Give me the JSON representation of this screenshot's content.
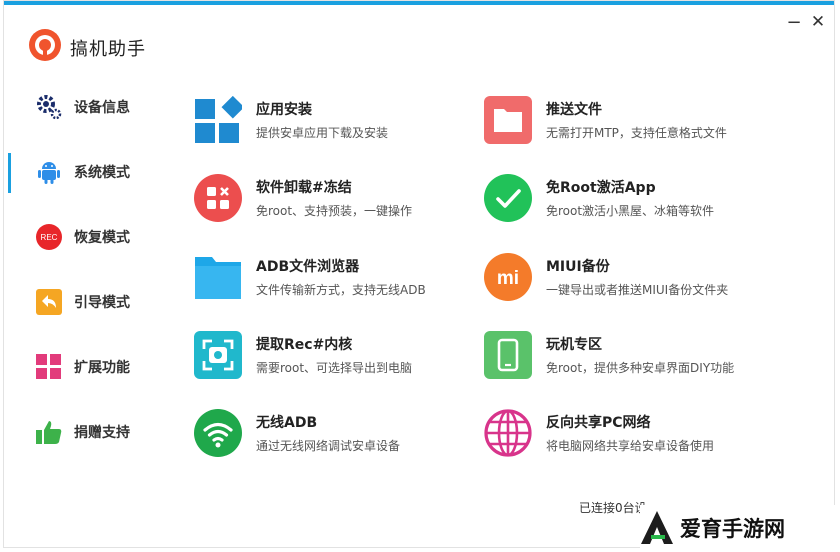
{
  "app": {
    "title": "搞机助手"
  },
  "window": {
    "minimize": "−",
    "close": "✕"
  },
  "sidebar": {
    "items": [
      {
        "label": "设备信息",
        "icon": "gear-icon"
      },
      {
        "label": "系统模式",
        "icon": "android-icon",
        "active": true
      },
      {
        "label": "恢复模式",
        "icon": "rec-icon",
        "badge": "REC"
      },
      {
        "label": "引导模式",
        "icon": "back-arrow-icon"
      },
      {
        "label": "扩展功能",
        "icon": "grid-icon"
      },
      {
        "label": "捐赠支持",
        "icon": "thumbs-up-icon"
      }
    ]
  },
  "features": {
    "left": [
      {
        "title": "应用安装",
        "desc": "提供安卓应用下载及安装",
        "icon": "app-install-icon"
      },
      {
        "title": "软件卸载#冻结",
        "desc": "免root、支持预装，一键操作",
        "icon": "uninstall-icon"
      },
      {
        "title": "ADB文件浏览器",
        "desc": "文件传输新方式，支持无线ADB",
        "icon": "folder-icon"
      },
      {
        "title": "提取Rec#内核",
        "desc": "需要root、可选择导出到电脑",
        "icon": "extract-icon"
      },
      {
        "title": "无线ADB",
        "desc": "通过无线网络调试安卓设备",
        "icon": "wifi-icon"
      }
    ],
    "right": [
      {
        "title": "推送文件",
        "desc": "无需打开MTP，支持任意格式文件",
        "icon": "push-file-icon"
      },
      {
        "title": "免Root激活App",
        "desc": "免root激活小黑屋、冰箱等软件",
        "icon": "check-icon"
      },
      {
        "title": "MIUI备份",
        "desc": "一键导出或者推送MIUI备份文件夹",
        "icon": "mi-icon",
        "badge": "mi"
      },
      {
        "title": "玩机专区",
        "desc": "免root，提供多种安卓界面DIY功能",
        "icon": "phone-icon"
      },
      {
        "title": "反向共享PC网络",
        "desc": "将电脑网络共享给安卓设备使用",
        "icon": "globe-icon"
      }
    ]
  },
  "status": {
    "text": "已连接0台设"
  },
  "watermark": {
    "text": "爱育手游网"
  }
}
